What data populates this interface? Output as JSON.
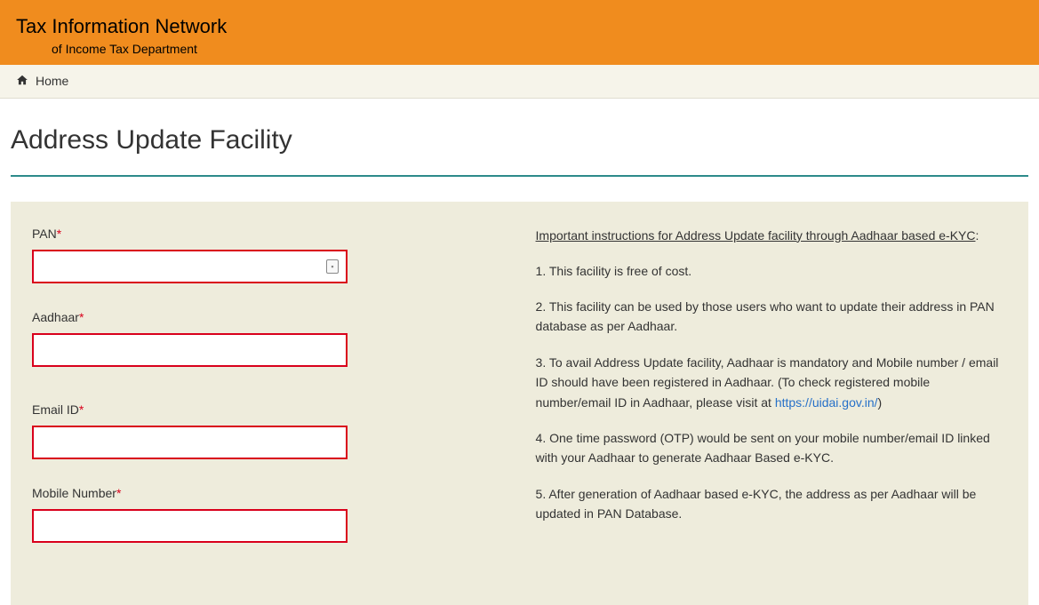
{
  "header": {
    "title": "Tax Information Network",
    "subtitle": "of Income Tax Department"
  },
  "breadcrumb": {
    "home": "Home"
  },
  "page": {
    "title": "Address Update Facility"
  },
  "form": {
    "pan": {
      "label": "PAN",
      "value": ""
    },
    "aadhaar": {
      "label": "Aadhaar",
      "value": ""
    },
    "email": {
      "label": "Email ID",
      "value": ""
    },
    "mobile": {
      "label": "Mobile Number",
      "value": ""
    },
    "required_marker": "*"
  },
  "info": {
    "heading": "Important instructions for Address Update facility through Aadhaar based e-KYC",
    "colon": ":",
    "p1": "1. This facility is free of cost.",
    "p2": "2. This facility can be used by those users who want to update their address in PAN database as per Aadhaar.",
    "p3a": "3. To avail Address Update facility, Aadhaar is mandatory and Mobile number / email ID should have been registered in Aadhaar. (To check registered mobile number/email ID in Aadhaar, please visit at ",
    "p3link": "https://uidai.gov.in/",
    "p3b": ")",
    "p4": "4. One time password (OTP) would be sent on your mobile number/email ID linked with your Aadhaar to generate Aadhaar Based e-KYC.",
    "p5": "5. After generation of Aadhaar based e-KYC, the address as per Aadhaar will be updated in PAN Database."
  }
}
